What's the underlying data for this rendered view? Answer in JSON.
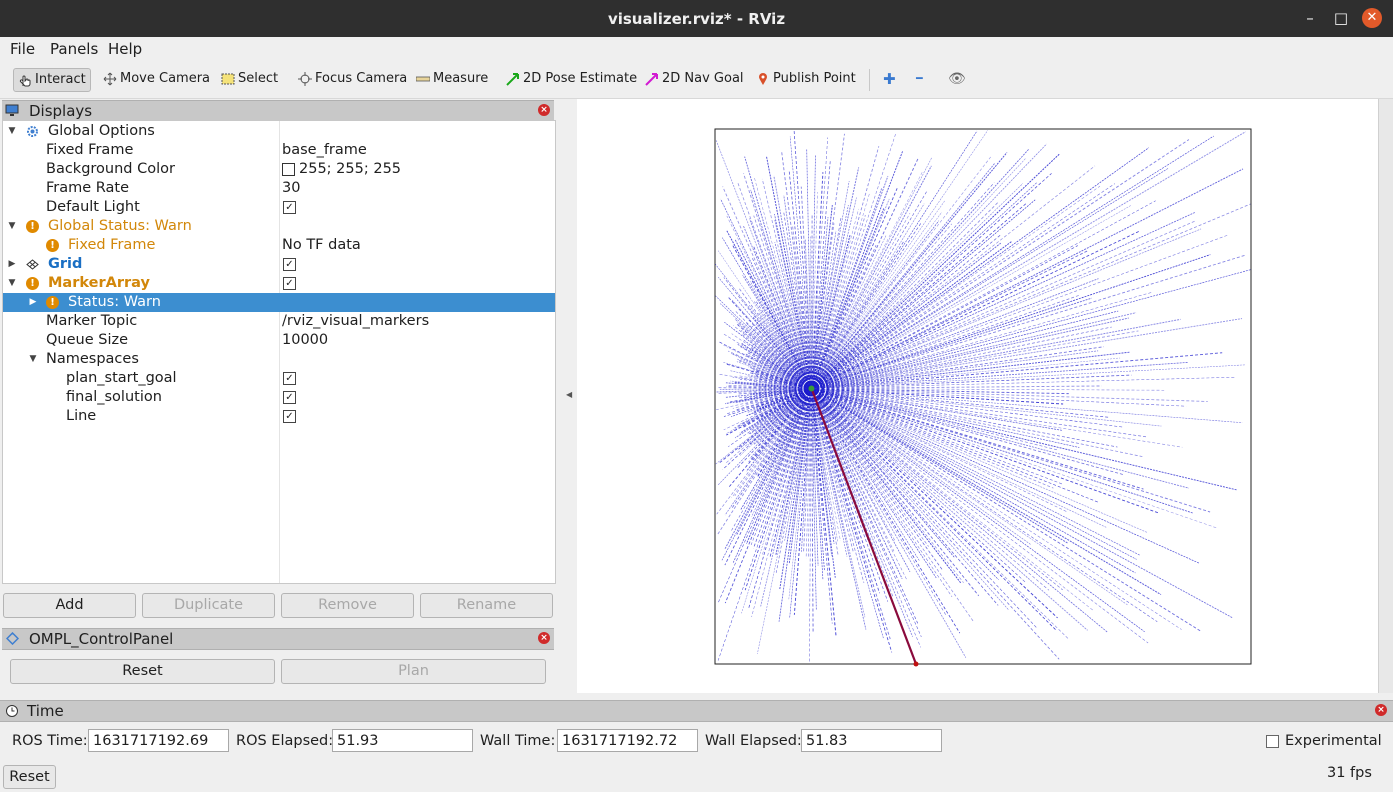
{
  "window": {
    "title": "visualizer.rviz* - RViz",
    "min_glyph": "–",
    "max_glyph": "□",
    "close_glyph": "✕"
  },
  "menu": [
    "File",
    "Panels",
    "Help"
  ],
  "toolbar": {
    "interact": "Interact",
    "move_camera": "Move Camera",
    "select": "Select",
    "focus_camera": "Focus Camera",
    "measure": "Measure",
    "pose_estimate": "2D Pose Estimate",
    "nav_goal": "2D Nav Goal",
    "publish_point": "Publish Point",
    "plus_glyph": "✚",
    "minus_glyph": "━",
    "eye_glyph": "👁"
  },
  "displays": {
    "title": "Displays",
    "rows": {
      "global_options": "Global Options",
      "fixed_frame_key": "Fixed Frame",
      "fixed_frame_val": "base_frame",
      "bg_color_key": "Background Color",
      "bg_color_val": "255; 255; 255",
      "frame_rate_key": "Frame Rate",
      "frame_rate_val": "30",
      "default_light_key": "Default Light",
      "global_status": "Global Status: Warn",
      "gs_fixed_frame": "Fixed Frame",
      "gs_fixed_frame_val": "No TF data",
      "grid": "Grid",
      "marker_array": "MarkerArray",
      "status_warn": "Status: Warn",
      "marker_topic_key": "Marker Topic",
      "marker_topic_val": "/rviz_visual_markers",
      "queue_size_key": "Queue Size",
      "queue_size_val": "10000",
      "namespaces": "Namespaces",
      "ns1": "plan_start_goal",
      "ns2": "final_solution",
      "ns3": "Line"
    },
    "check_glyph": "✓",
    "warn_glyph": "!",
    "buttons": {
      "add": "Add",
      "duplicate": "Duplicate",
      "remove": "Remove",
      "rename": "Rename"
    }
  },
  "ompl": {
    "title": "OMPL_ControlPanel",
    "reset": "Reset",
    "plan": "Plan"
  },
  "time": {
    "title": "Time",
    "ros_time_label": "ROS Time:",
    "ros_time": "1631717192.69",
    "ros_elapsed_label": "ROS Elapsed:",
    "ros_elapsed": "51.93",
    "wall_time_label": "Wall Time:",
    "wall_time": "1631717192.72",
    "wall_elapsed_label": "Wall Elapsed:",
    "wall_elapsed": "51.83",
    "experimental": "Experimental",
    "reset": "Reset",
    "fps": "31 fps"
  },
  "viz": {
    "colors": {
      "rays": "#1c1ccc",
      "solution": "#8a0a3c",
      "center": "#3a9a3a"
    },
    "center": [
      0.18,
      0.5
    ],
    "goal": [
      0.375,
      1.0
    ]
  }
}
